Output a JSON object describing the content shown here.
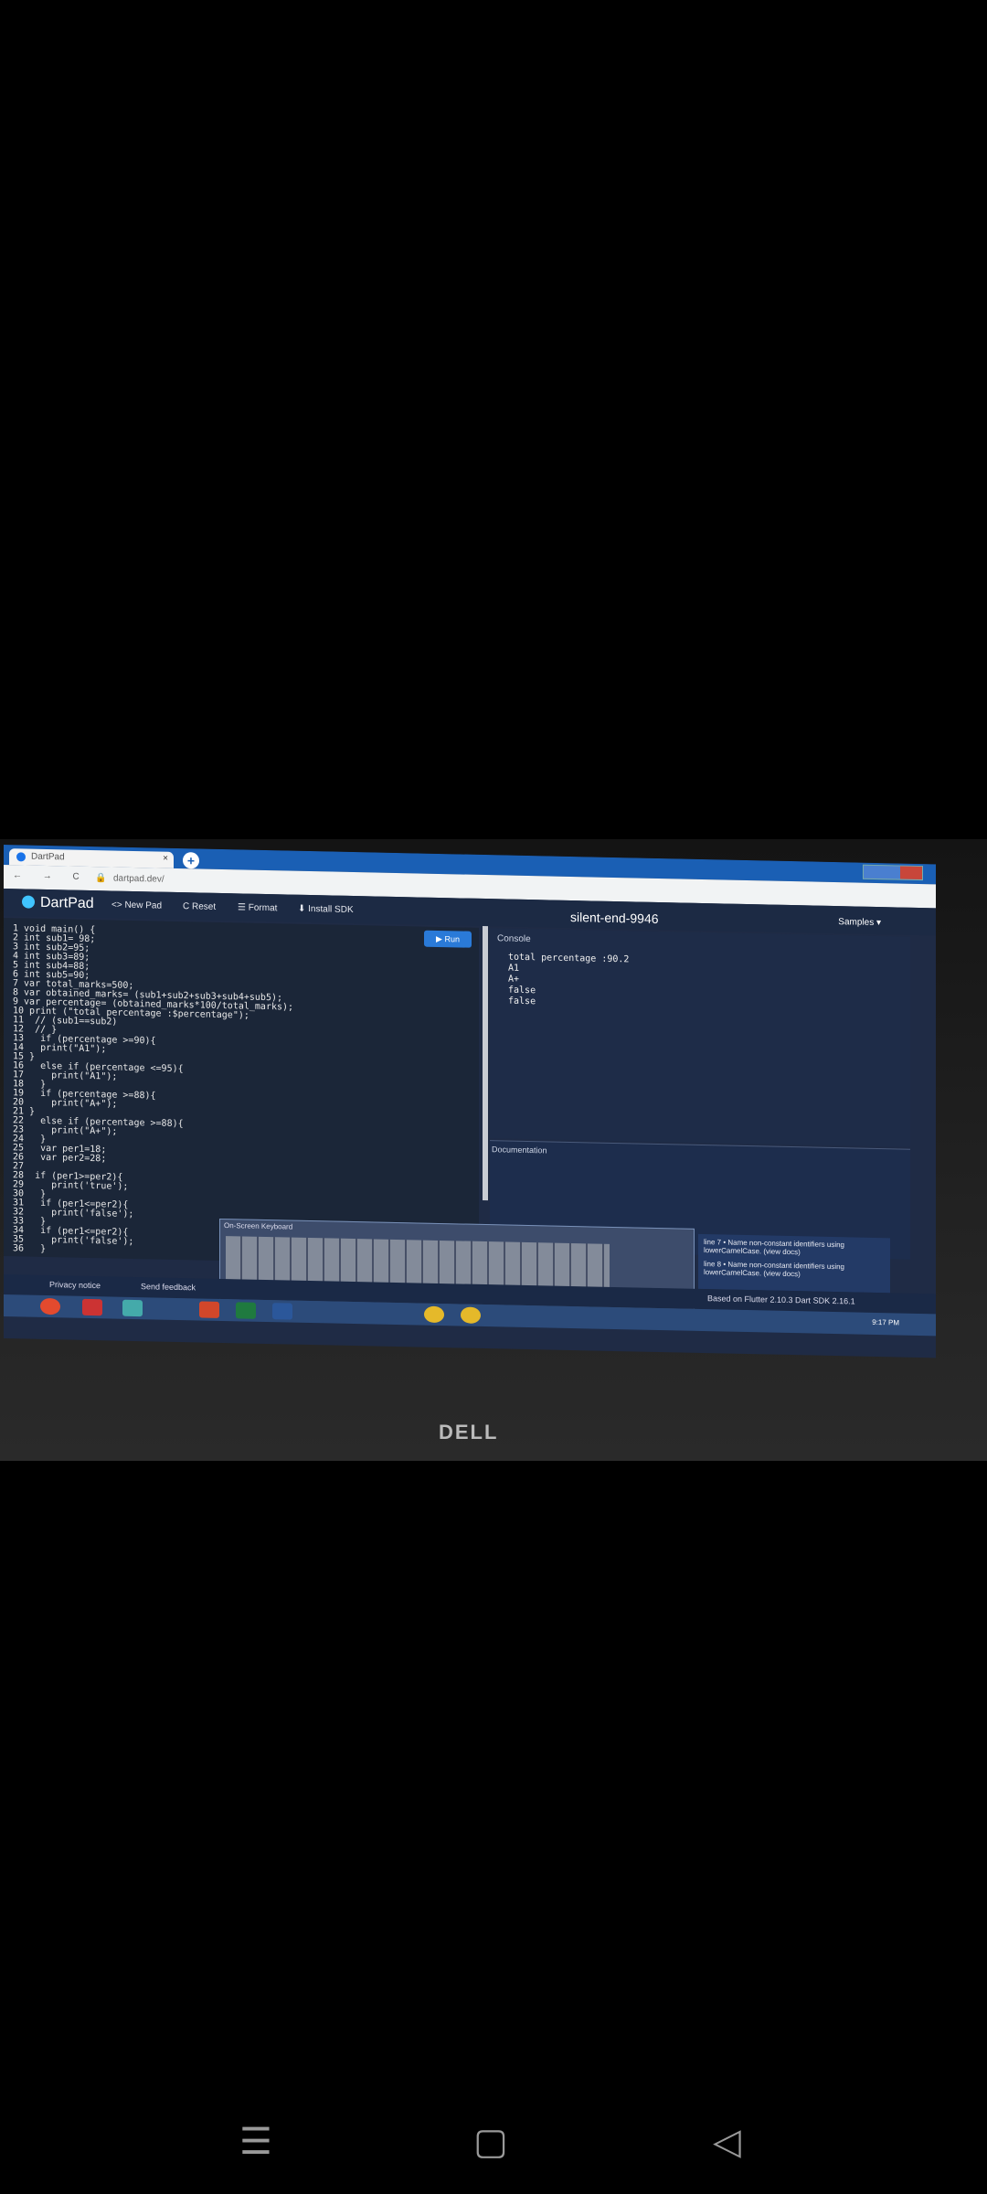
{
  "browser": {
    "tab_title": "DartPad",
    "tab_close": "×",
    "new_tab": "+",
    "url": "dartpad.dev/",
    "nav_glyphs": "← → C"
  },
  "app": {
    "brand": "DartPad",
    "new_pad": "<> New Pad",
    "reset": "C Reset",
    "format": "☰ Format",
    "install_sdk": "⬇ Install SDK",
    "pad_name": "silent-end-9946",
    "samples": "Samples ▾",
    "run": "▶ Run"
  },
  "code_lines": [
    "1 void main() {",
    "2 int sub1= 98;",
    "3 int sub2=95;",
    "4 int sub3=89;",
    "5 int sub4=88;",
    "6 int sub5=90;",
    "7 var total_marks=500;",
    "8 var obtained_marks= (sub1+sub2+sub3+sub4+sub5);",
    "9 var percentage= (obtained_marks*100/total_marks);",
    "10 print (\"total percentage :$percentage\");",
    "11  // (sub1==sub2)",
    "12  // }",
    "13   if (percentage >=90){",
    "14   print(\"A1\");",
    "15 }",
    "16   else if (percentage <=95){",
    "17     print(\"A1\");",
    "18   }",
    "19   if (percentage >=88){",
    "20     print(\"A+\");",
    "21 }",
    "22   else if (percentage >=88){",
    "23     print(\"A+\");",
    "24   }",
    "25   var per1=18;",
    "26   var per2=28;",
    "27",
    "28  if (per1>=per2){",
    "29     print('true');",
    "30   }",
    "31   if (per1<=per2){",
    "32     print('false');",
    "33   }",
    "34   if (per1<=per2){",
    "35     print('false');",
    "36   }"
  ],
  "console": {
    "label": "Console",
    "output": [
      "total percentage :90.2",
      "A1",
      "A+",
      "false",
      "false"
    ]
  },
  "documentation": {
    "label": "Documentation"
  },
  "keyboard": {
    "title": "On-Screen Keyboard"
  },
  "warnings": [
    "line 7 • Name non-constant identifiers using lowerCamelCase. (view docs)",
    "line 8 • Name non-constant identifiers using lowerCamelCase. (view docs)"
  ],
  "footer": {
    "privacy": "Privacy notice",
    "feedback": "Send feedback",
    "version": "Based on Flutter 2.10.3 Dart SDK 2.16.1"
  },
  "taskbar": {
    "time": "9:17 PM"
  },
  "monitor": {
    "brand": "DELL"
  },
  "android_nav": {
    "recents": "☰",
    "home": "▢",
    "back": "◁"
  }
}
